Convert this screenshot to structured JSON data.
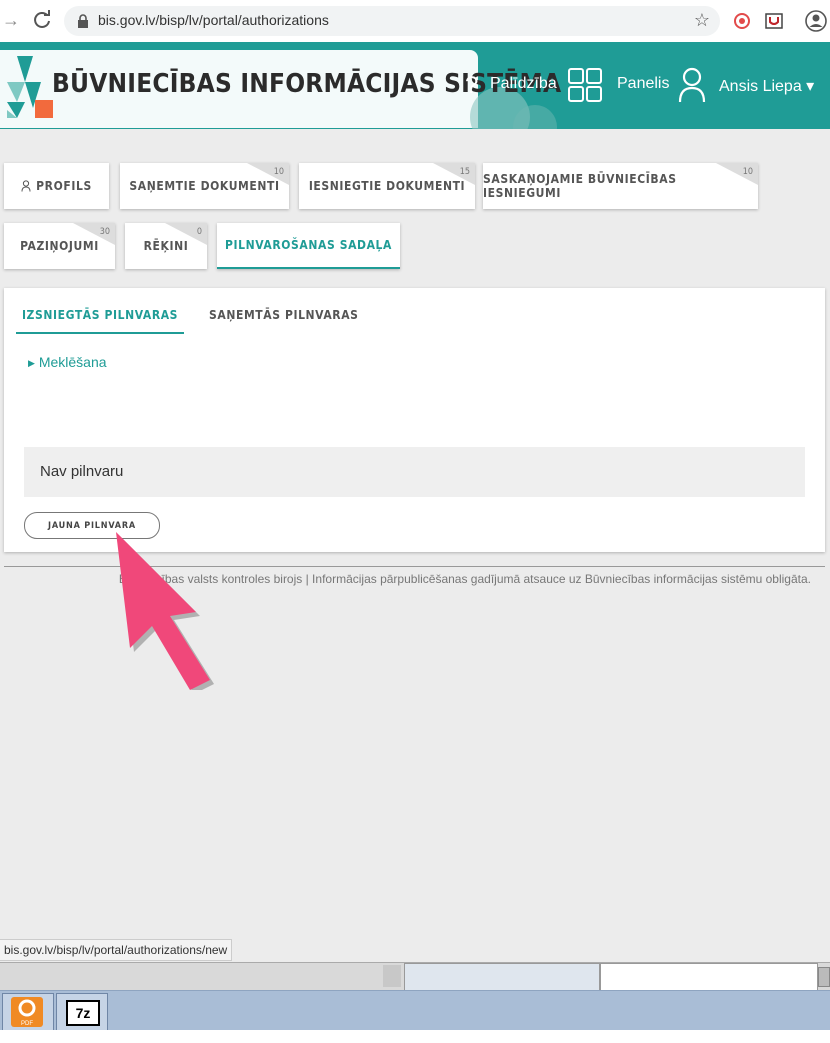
{
  "browser": {
    "url": "bis.gov.lv/bisp/lv/portal/authorizations",
    "status_url": "bis.gov.lv/bisp/lv/portal/authorizations/new"
  },
  "header": {
    "site_title": "BŪVNIECĪBAS INFORMĀCIJAS SISTĒMA",
    "help_label": "Palīdzība",
    "panel_label": "Panelis",
    "user_name": "Ansis Liepa",
    "user_caret": "▾",
    "accent_color": "#1f9c96"
  },
  "tabs": [
    {
      "label": "PROFILS",
      "badge": ""
    },
    {
      "label": "SAŅEMTIE DOKUMENTI",
      "badge": "10"
    },
    {
      "label": "IESNIEGTIE DOKUMENTI",
      "badge": "15"
    },
    {
      "label": "SASKAŅOJAMIE BŪVNIECĪBAS IESNIEGUMI",
      "badge": "10"
    },
    {
      "label": "PAZIŅOJUMI",
      "badge": "30"
    },
    {
      "label": "RĒĶINI",
      "badge": "0"
    },
    {
      "label": "PILNVAROŠANAS SADAĻA",
      "badge": ""
    }
  ],
  "subtabs": {
    "issued": "IZSNIEGTĀS PILNVARAS",
    "received": "SAŅEMTĀS PILNVARAS"
  },
  "search_toggle": "Meklēšana",
  "empty_message": "Nav pilnvaru",
  "new_button": "JAUNA PILNVARA",
  "footer_text": "Būvniecības valsts kontroles birojs | Informācijas pārpublicēšanas gadījumā atsauce uz Būvniecības informācijas sistēmu obligāta.",
  "taskbar": {
    "app1_caption": "PDF",
    "app2_caption": "7z"
  }
}
